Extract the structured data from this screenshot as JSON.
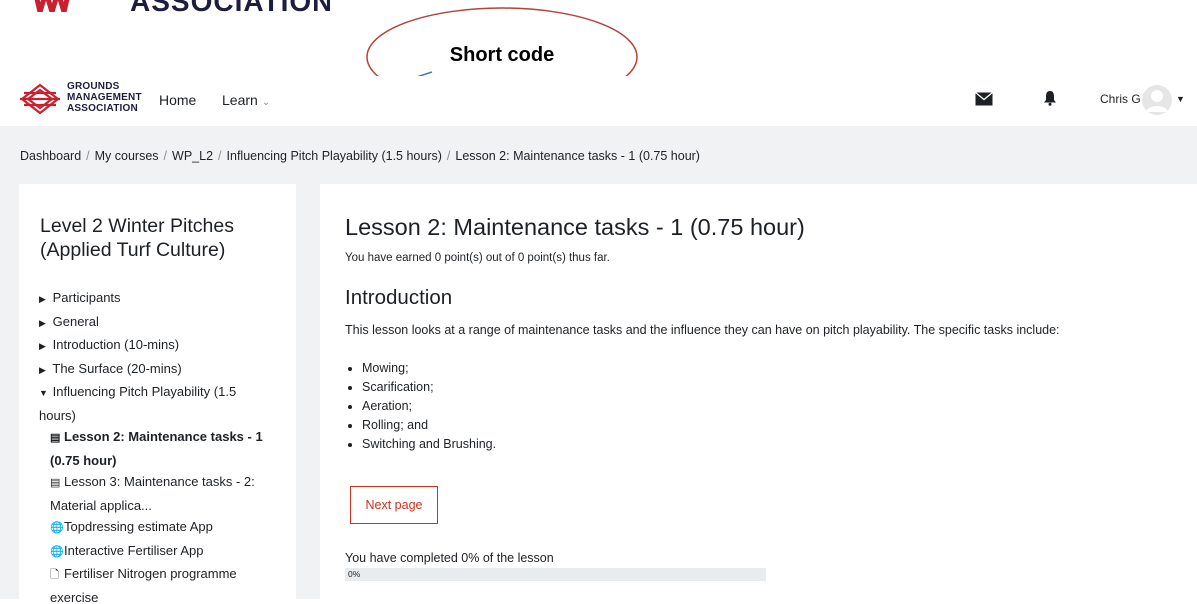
{
  "top_logo": {
    "word": "ASSOCIATION"
  },
  "annotation": {
    "callout_text": "Short code"
  },
  "navbar": {
    "brand_line1": "GROUNDS",
    "brand_line2": "MANAGEMENT",
    "brand_line3": "ASSOCIATION",
    "home_label": "Home",
    "learn_label": "Learn",
    "user_name": "Chris G",
    "icons": [
      "envelope-icon",
      "bell-icon",
      "avatar",
      "caret-down-icon"
    ]
  },
  "breadcrumb": [
    "Dashboard",
    "My courses",
    "WP_L2",
    "Influencing Pitch Playability (1.5 hours)",
    "Lesson 2: Maintenance tasks - 1 (0.75 hour)"
  ],
  "drawer": {
    "course_title": "Level 2 Winter Pitches (Applied Turf Culture)",
    "items": [
      "Participants",
      "General",
      "Introduction (10-mins)",
      "The Surface (20-mins)",
      "Influencing Pitch Playability (1.5 hours)"
    ],
    "sub_items": [
      "Lesson 2: Maintenance tasks - 1 (0.75 hour)",
      "Lesson 3: Maintenance tasks - 2: Material applica...",
      "Topdressing estimate App",
      "Interactive Fertiliser App",
      "Fertiliser Nitrogen programme exercise"
    ]
  },
  "main": {
    "title": "Lesson 2: Maintenance tasks - 1 (0.75 hour)",
    "earned": "You have earned 0 point(s) out of 0 point(s) thus far.",
    "section_heading": "Introduction",
    "description": "This lesson looks at a range of maintenance tasks and the influence they can have on pitch playability. The specific tasks include:",
    "tasks": [
      "Mowing;",
      "Scarification;",
      "Aeration;",
      "Rolling; and",
      "Switching and Brushing."
    ],
    "next_button": "Next page",
    "completed_text": "You have completed 0% of the lesson",
    "progress_label": "0%",
    "progress_value": 0
  },
  "colors": {
    "accent": "#ca3120",
    "page_bg": "#f1f2f4",
    "arrow": "#4a7ab5"
  }
}
